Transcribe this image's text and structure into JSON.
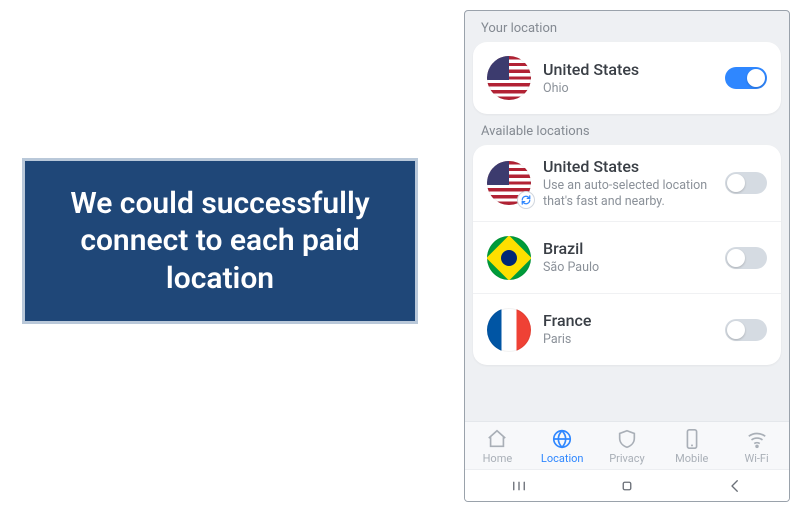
{
  "caption": "We could successfully connect to each paid location",
  "sections": {
    "your_location_label": "Your location",
    "available_label": "Available locations"
  },
  "current": {
    "title": "United States",
    "subtitle": "Ohio",
    "flag": "us",
    "enabled": true
  },
  "available": [
    {
      "title": "United States",
      "subtitle": "Use an auto-selected location that's fast and nearby.",
      "flag": "us",
      "auto": true,
      "enabled": false
    },
    {
      "title": "Brazil",
      "subtitle": "São Paulo",
      "flag": "br",
      "auto": false,
      "enabled": false
    },
    {
      "title": "France",
      "subtitle": "Paris",
      "flag": "fr",
      "auto": false,
      "enabled": false
    }
  ],
  "nav": {
    "items": [
      {
        "label": "Home",
        "icon": "home",
        "active": false
      },
      {
        "label": "Location",
        "icon": "globe",
        "active": true
      },
      {
        "label": "Privacy",
        "icon": "shield",
        "active": false
      },
      {
        "label": "Mobile",
        "icon": "mobile",
        "active": false
      },
      {
        "label": "Wi-Fi",
        "icon": "wifi",
        "active": false
      }
    ]
  }
}
